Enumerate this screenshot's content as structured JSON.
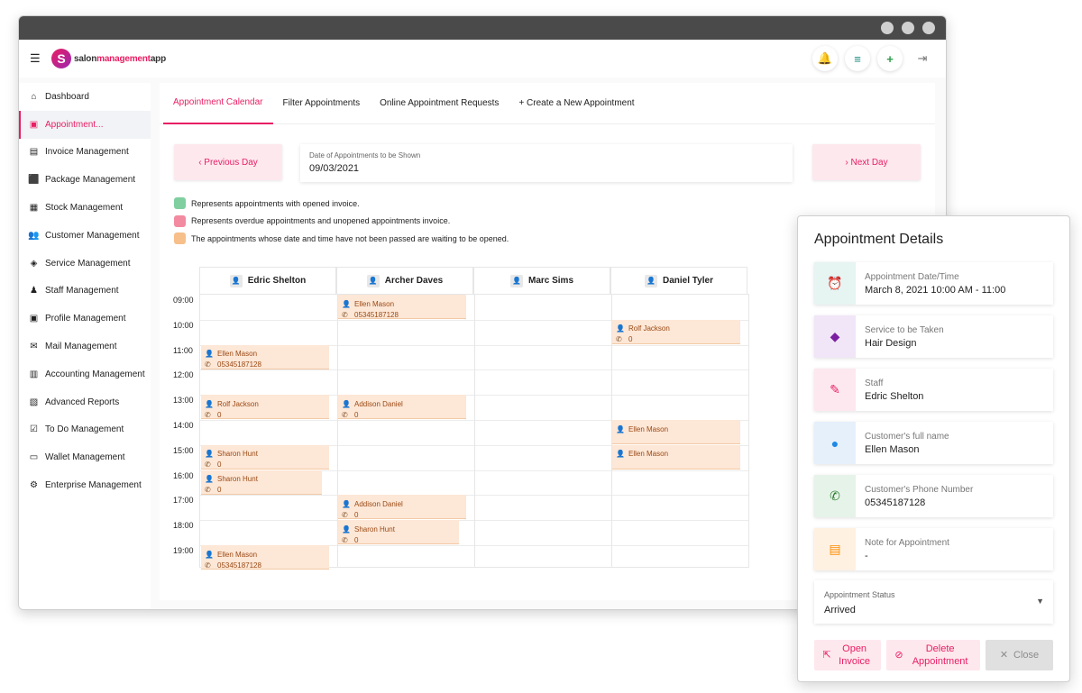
{
  "app": {
    "logo_letter": "S",
    "logo_text_a": "salon",
    "logo_text_b": "management",
    "logo_text_c": "app"
  },
  "topbar": {
    "icons": [
      "bell-icon",
      "list-icon",
      "plus-icon",
      "logout-icon"
    ]
  },
  "sidebar": {
    "items": [
      {
        "label": "Dashboard",
        "icon": "⌂"
      },
      {
        "label": "Appointment...",
        "icon": "▣"
      },
      {
        "label": "Invoice Management",
        "icon": "▤"
      },
      {
        "label": "Package Management",
        "icon": "⬛"
      },
      {
        "label": "Stock Management",
        "icon": "▦"
      },
      {
        "label": "Customer Management",
        "icon": "👥"
      },
      {
        "label": "Service Management",
        "icon": "◈"
      },
      {
        "label": "Staff Management",
        "icon": "♟"
      },
      {
        "label": "Profile Management",
        "icon": "▣"
      },
      {
        "label": "Mail Management",
        "icon": "✉"
      },
      {
        "label": "Accounting Management",
        "icon": "▥"
      },
      {
        "label": "Advanced Reports",
        "icon": "▧"
      },
      {
        "label": "To Do Management",
        "icon": "☑"
      },
      {
        "label": "Wallet Management",
        "icon": "▭"
      },
      {
        "label": "Enterprise Management",
        "icon": "⚙"
      }
    ]
  },
  "tabs": [
    {
      "label": "Appointment Calendar"
    },
    {
      "label": "Filter Appointments"
    },
    {
      "label": "Online Appointment Requests"
    },
    {
      "label": "+ Create a New Appointment"
    }
  ],
  "daybar": {
    "prev_label": "‹  Previous Day",
    "next_label": "›  Next Day",
    "date_label": "Date of Appointments to be Shown",
    "date_value": "09/03/2021"
  },
  "legend": [
    {
      "color": "#7fcf9f",
      "text": "Represents appointments with opened invoice."
    },
    {
      "color": "#f28ba0",
      "text": "Represents overdue appointments and unopened appointments invoice."
    },
    {
      "color": "#f7bf8a",
      "text": "The appointments whose date and time have not been passed are waiting to be opened."
    }
  ],
  "calendar": {
    "staff": [
      "Edric Shelton",
      "Archer Daves",
      "Marc Sims",
      "Daniel Tyler"
    ],
    "times": [
      "09:00",
      "10:00",
      "11:00",
      "12:00",
      "13:00",
      "14:00",
      "15:00",
      "16:00",
      "17:00",
      "18:00",
      "19:00"
    ],
    "appointments": [
      {
        "col": 1,
        "slot": 0,
        "name": "Ellen Mason",
        "phone": "05345187128"
      },
      {
        "col": 3,
        "slot": 1,
        "name": "Rolf Jackson",
        "phone": "0"
      },
      {
        "col": 0,
        "slot": 2,
        "name": "Ellen Mason",
        "phone": "05345187128"
      },
      {
        "col": 0,
        "slot": 4,
        "name": "Rolf Jackson",
        "phone": "0"
      },
      {
        "col": 1,
        "slot": 4,
        "name": "Addison Daniel",
        "phone": "0"
      },
      {
        "col": 3,
        "slot": 5,
        "name": "Ellen Mason",
        "phone": ""
      },
      {
        "col": 0,
        "slot": 6,
        "name": "Sharon Hunt",
        "phone": "0"
      },
      {
        "col": 3,
        "slot": 6,
        "name": "Ellen Mason",
        "phone": ""
      },
      {
        "col": 0,
        "slot": 7,
        "name": "Sharon Hunt",
        "phone": "0"
      },
      {
        "col": 1,
        "slot": 8,
        "name": "Addison Daniel",
        "phone": "0"
      },
      {
        "col": 1,
        "slot": 9,
        "name": "Sharon Hunt",
        "phone": "0"
      },
      {
        "col": 0,
        "slot": 10,
        "name": "Ellen Mason",
        "phone": "05345187128"
      }
    ]
  },
  "panel": {
    "title": "Appointment Details",
    "details": [
      {
        "label": "Appointment Date/Time",
        "value": "March 8, 2021 10:00 AM - 11:00",
        "icon": "⏰",
        "icon_color": "#1e8c7e",
        "bg": "#e6f4f2"
      },
      {
        "label": "Service to be Taken",
        "value": "Hair Design",
        "icon": "◆",
        "icon_color": "#7b1fa2",
        "bg": "#f1e6f7"
      },
      {
        "label": "Staff",
        "value": "Edric Shelton",
        "icon": "✎",
        "icon_color": "#e91e63",
        "bg": "#fde8ef"
      },
      {
        "label": "Customer's full name",
        "value": "Ellen Mason",
        "icon": "●",
        "icon_color": "#1e88e5",
        "bg": "#e6f0fb"
      },
      {
        "label": "Customer's Phone Number",
        "value": "05345187128",
        "icon": "✆",
        "icon_color": "#2e7d32",
        "bg": "#e6f3e9"
      },
      {
        "label": "Note for Appointment",
        "value": "-",
        "icon": "▤",
        "icon_color": "#fb8c00",
        "bg": "#fef1e2"
      }
    ],
    "status_label": "Appointment Status",
    "status_value": "Arrived",
    "open_invoice": "Open Invoice",
    "delete_appointment": "Delete Appointment",
    "close": "Close"
  }
}
